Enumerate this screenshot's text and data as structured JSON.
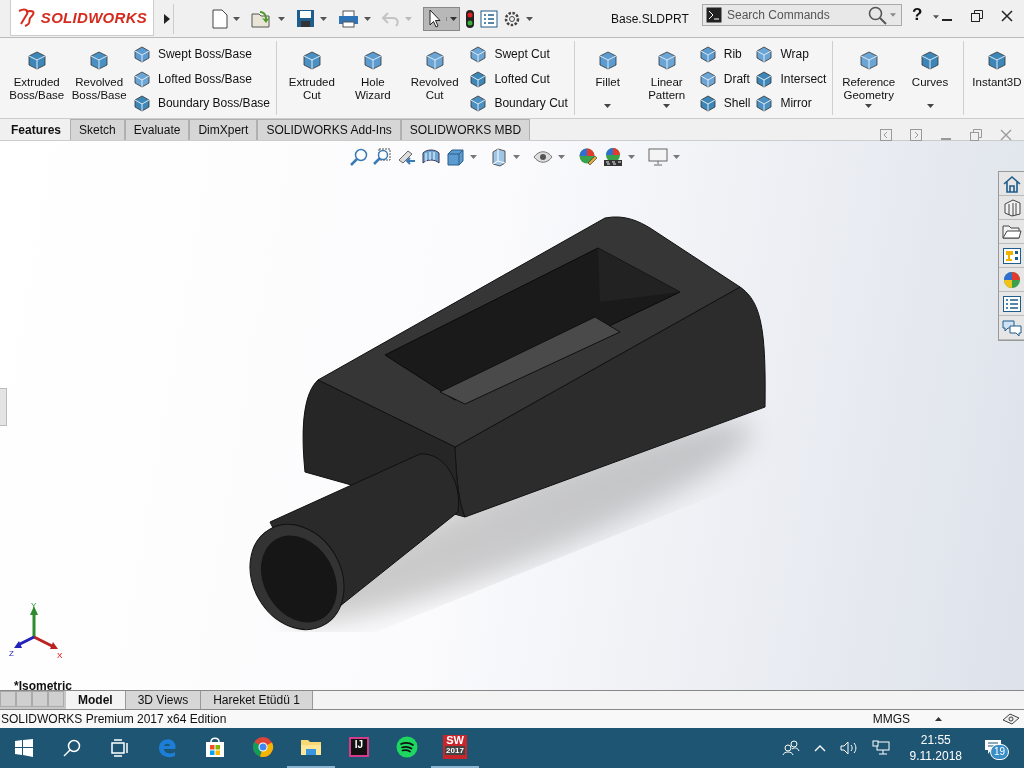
{
  "title_bar": {
    "logo": "SOLIDWORKS",
    "title": "Base.SLDPRT",
    "search": {
      "placeholder": "Search Commands"
    },
    "help": "?"
  },
  "ribbon": {
    "groups": [
      {
        "items": [
          {
            "kind": "large",
            "label": "Extruded Boss/Base",
            "dropdown": false
          },
          {
            "kind": "large",
            "label": "Revolved Boss/Base",
            "dropdown": false
          },
          {
            "kind": "stack",
            "buttons": [
              "Swept Boss/Base",
              "Lofted Boss/Base",
              "Boundary Boss/Base"
            ]
          }
        ]
      },
      {
        "items": [
          {
            "kind": "large",
            "label": "Extruded Cut",
            "dropdown": false
          },
          {
            "kind": "large",
            "label": "Hole Wizard",
            "dropdown": false
          },
          {
            "kind": "large",
            "label": "Revolved Cut",
            "dropdown": false
          },
          {
            "kind": "stack",
            "buttons": [
              "Swept Cut",
              "Lofted Cut",
              "Boundary Cut"
            ]
          }
        ]
      },
      {
        "items": [
          {
            "kind": "large",
            "label": "Fillet",
            "dropdown": true
          },
          {
            "kind": "large",
            "label": "Linear Pattern",
            "dropdown": true
          },
          {
            "kind": "stack",
            "buttons": [
              "Rib",
              "Draft",
              "Shell"
            ]
          },
          {
            "kind": "stack",
            "buttons": [
              "Wrap",
              "Intersect",
              "Mirror"
            ]
          }
        ]
      },
      {
        "items": [
          {
            "kind": "large",
            "label": "Reference Geometry",
            "dropdown": true
          },
          {
            "kind": "large",
            "label": "Curves",
            "dropdown": true
          }
        ]
      },
      {
        "items": [
          {
            "kind": "large",
            "label": "Instant3D",
            "dropdown": false
          }
        ]
      }
    ]
  },
  "tabs": [
    {
      "label": "Features",
      "selected": true
    },
    {
      "label": "Sketch",
      "selected": false
    },
    {
      "label": "Evaluate",
      "selected": false
    },
    {
      "label": "DimXpert",
      "selected": false
    },
    {
      "label": "SOLIDWORKS Add-Ins",
      "selected": false
    },
    {
      "label": "SOLIDWORKS MBD",
      "selected": false
    }
  ],
  "viewport": {
    "view_name": "*Isometric",
    "triad": {
      "x": "X",
      "y": "Y",
      "z": "Z"
    }
  },
  "model_tabs": [
    {
      "label": "Model",
      "selected": true
    },
    {
      "label": "3D Views",
      "selected": false
    },
    {
      "label": "Hareket Etüdü 1",
      "selected": false
    }
  ],
  "status_bar": {
    "text": "SOLIDWORKS Premium 2017 x64 Edition",
    "units": "MMGS"
  },
  "taskbar": {
    "apps": [
      {
        "kind": "edge",
        "running": false
      },
      {
        "kind": "store",
        "running": false
      },
      {
        "kind": "chrome",
        "running": false
      },
      {
        "kind": "explorer",
        "running": true
      },
      {
        "kind": "intellij",
        "label": "IJ",
        "running": false
      },
      {
        "kind": "spotify",
        "running": false
      },
      {
        "kind": "solidworks",
        "label": "SW",
        "sublabel": "2017",
        "running": true
      }
    ],
    "time": "21:55",
    "date": "9.11.2018",
    "notifications": "19"
  }
}
